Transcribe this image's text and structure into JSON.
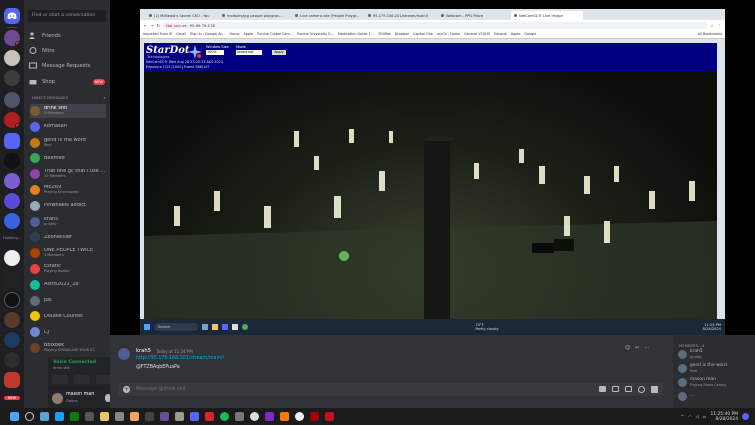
{
  "servers": [
    {
      "tag": ""
    },
    {
      "tag": "",
      "count": "6"
    },
    {
      "tag": ""
    },
    {
      "tag": ""
    },
    {
      "tag": "",
      "count": "1"
    },
    {
      "tag": ""
    },
    {
      "tag": ""
    },
    {
      "tag": ""
    },
    {
      "tag": ""
    },
    {
      "tag": ""
    },
    {
      "tag": ""
    },
    {
      "tag": ""
    },
    {
      "tag": ""
    },
    {
      "tag": "Flanking..."
    },
    {
      "tag": ""
    },
    {
      "tag": ""
    },
    {
      "tag": ""
    },
    {
      "tag": ""
    },
    {
      "tag": ""
    },
    {
      "tag": ""
    },
    {
      "tag": ""
    },
    {
      "tag": "",
      "count": "NEW"
    }
  ],
  "sidebar": {
    "search_placeholder": "Find or start a conversation",
    "nav": [
      {
        "label": "Friends"
      },
      {
        "label": "Nitro"
      },
      {
        "label": "Message Requests"
      },
      {
        "label": "Shop",
        "badge": "NEW"
      }
    ],
    "dm_header": "DIRECT MESSAGES",
    "dm_add": "+",
    "dms": [
      {
        "name": "drink shit",
        "sub": "5 Members",
        "color": "#7a5a3a"
      },
      {
        "name": "Komasan",
        "sub": "",
        "color": "#5865f2"
      },
      {
        "name": "gend is the word",
        "sub": "Reel",
        "color": "#c27c0e"
      },
      {
        "name": "Beemed",
        "sub": "",
        "color": "#3ba55c"
      },
      {
        "name": "That one gc that i use ...",
        "sub": "10 Members",
        "color": "#8e44ad"
      },
      {
        "name": "MEZ69",
        "sub": "Playing Uncensored",
        "color": "#e67e22"
      },
      {
        "name": "Pinwheels addict",
        "sub": "",
        "color": "#99aab5"
      },
      {
        "name": "krah5",
        "sub": "gruddy",
        "color": "#4e5d94"
      },
      {
        "name": "Zbonekiller",
        "sub": "",
        "color": "#2c3e50"
      },
      {
        "name": "ONE PEOPLE TWICE",
        "sub": "3 Members",
        "color": "#a84300"
      },
      {
        "name": "Estatic",
        "sub": "Playing Roblox",
        "color": "#ed4245"
      },
      {
        "name": "Astro2021_28",
        "sub": "",
        "color": "#1abc9c"
      },
      {
        "name": "pal",
        "sub": "",
        "color": "#5d6d7e"
      },
      {
        "name": "Double Counter",
        "sub": "",
        "color": "#f1c40f"
      },
      {
        "name": "CJ",
        "sub": "",
        "color": "#7289da"
      },
      {
        "name": "Bbixbek",
        "sub": "Playing SHOWCASE YOUR ST...",
        "color": "#6b4226"
      }
    ],
    "voice_status": "Voice Connected",
    "voice_channel": "drink shit",
    "user_name": "mason man",
    "user_status": "Online"
  },
  "browser": {
    "tabs": [
      {
        "label": "(2) McBeast's Secret CEO - You"
      },
      {
        "label": "modules/jpg people playgrou..."
      },
      {
        "label": "Live camera site (People Playgr..."
      },
      {
        "label": "95.179.156.201/stream/main/l"
      },
      {
        "label": "Webcam - PPG Place"
      },
      {
        "label": "NetCamSC® Live Image",
        "active": true
      }
    ],
    "not_secure": "Not secure",
    "url": "95.69.79.178",
    "bookmarks": [
      "Imported From IE",
      "Gmail",
      "Sign in - Google Ac...",
      "Home",
      "Apple",
      "Purdue Global Cam...",
      "Purdue University G...",
      "Medication Guide | ...",
      "YOURet",
      "Dropbox",
      "Capital One",
      "myCK - Home",
      "Geneva VCVHS",
      "Eduone",
      "Apple",
      "Google"
    ],
    "all_bookmarks": "All Bookmarks"
  },
  "camera": {
    "brand": "StarDot",
    "brand_sub": "Technologies",
    "window_size_label": "Window Size",
    "window_size_value": "100%",
    "mode_label": "Mode",
    "mode_value": "Javascript",
    "apply_label": "Apply",
    "info_line1": "NetCamSC® Wed Aug 28 23:25:33 AKS 2024",
    "info_line2": "Exposure 1/25 [1000] Frame 586/107"
  },
  "inner_taskbar": {
    "search_label": "Search",
    "weather_temp": "74°F",
    "weather_desc": "Partly cloudy",
    "time": "11:25 PM",
    "date": "8/28/2024"
  },
  "chat": {
    "author": "krah5",
    "timestamp": "Today at 11:24 PM",
    "link": "http://95.179.168.201/stream/main/l",
    "message": "@FTZBAqbEPuaPa",
    "input_placeholder": "Message @drink shit"
  },
  "members": {
    "header": "MEMBERS—4",
    "list": [
      {
        "name": "krah5",
        "sub": "gruddy"
      },
      {
        "name": "gend is the word",
        "sub": "Reel"
      },
      {
        "name": "mason man",
        "sub": "Playing Roma Canary"
      },
      {
        "name": "...",
        "sub": ""
      }
    ]
  },
  "taskbar": {
    "time": "11:25:40 PM",
    "date": "8/28/2024"
  }
}
